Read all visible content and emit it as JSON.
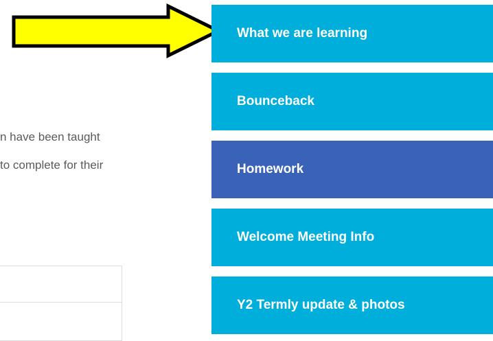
{
  "content": {
    "line_1": "n have been taught",
    "line_2": "to complete for their"
  },
  "nav": {
    "items": [
      {
        "label": "What we are learning"
      },
      {
        "label": "Bounceback"
      },
      {
        "label": "Homework"
      },
      {
        "label": "Welcome Meeting Info"
      },
      {
        "label": "Y2 Termly update & photos"
      }
    ],
    "active_index": 2
  },
  "colors": {
    "nav_item": "#00aedb",
    "nav_item_active": "#3a63b7",
    "arrow_fill": "#ffff00",
    "arrow_stroke": "#000000"
  }
}
